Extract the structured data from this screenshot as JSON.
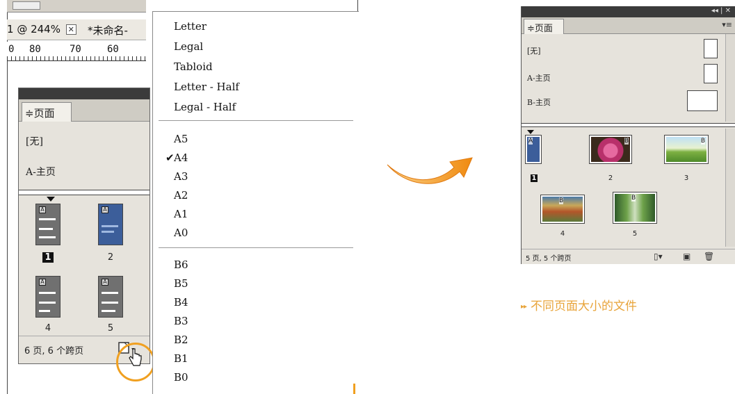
{
  "left": {
    "doc_tab_1": "@ 244%",
    "doc_tab_1_prefix": "1",
    "doc_tab_2": "*未命名-",
    "ruler_labels": [
      "0",
      "80",
      "70",
      "60"
    ],
    "pages_panel": {
      "tab_label": "≑页面",
      "masters": [
        "[无]",
        "A-主页"
      ],
      "page_numbers": [
        "1",
        "2",
        "4",
        "5"
      ],
      "thumb_tag": "A",
      "status": "6 页, 6 个跨页"
    },
    "dropdown": {
      "group1": [
        "Letter",
        "Legal",
        "Tabloid",
        "Letter - Half",
        "Legal - Half"
      ],
      "group2": [
        "A5",
        "A4",
        "A3",
        "A2",
        "A1",
        "A0"
      ],
      "group3": [
        "B6",
        "B5",
        "B4",
        "B3",
        "B2",
        "B1",
        "B0"
      ],
      "checked": "A4",
      "check_symbol": "✔"
    },
    "accent_color": "#f0a020"
  },
  "right": {
    "tab_label": "≑页面",
    "menu_symbol": "▾≡",
    "top_controls": "◂◂ | ✕",
    "masters": [
      "[无]",
      "A-主页",
      "B-主页"
    ],
    "page_tags": [
      "A",
      "B",
      "B",
      "B",
      "B"
    ],
    "page_numbers": [
      "1",
      "2",
      "3",
      "4",
      "5"
    ],
    "status": "5 页, 5 个跨页"
  },
  "caption": {
    "marker": "▸▸",
    "text": "不同页面大小的文件",
    "color": "#e8a43a"
  }
}
